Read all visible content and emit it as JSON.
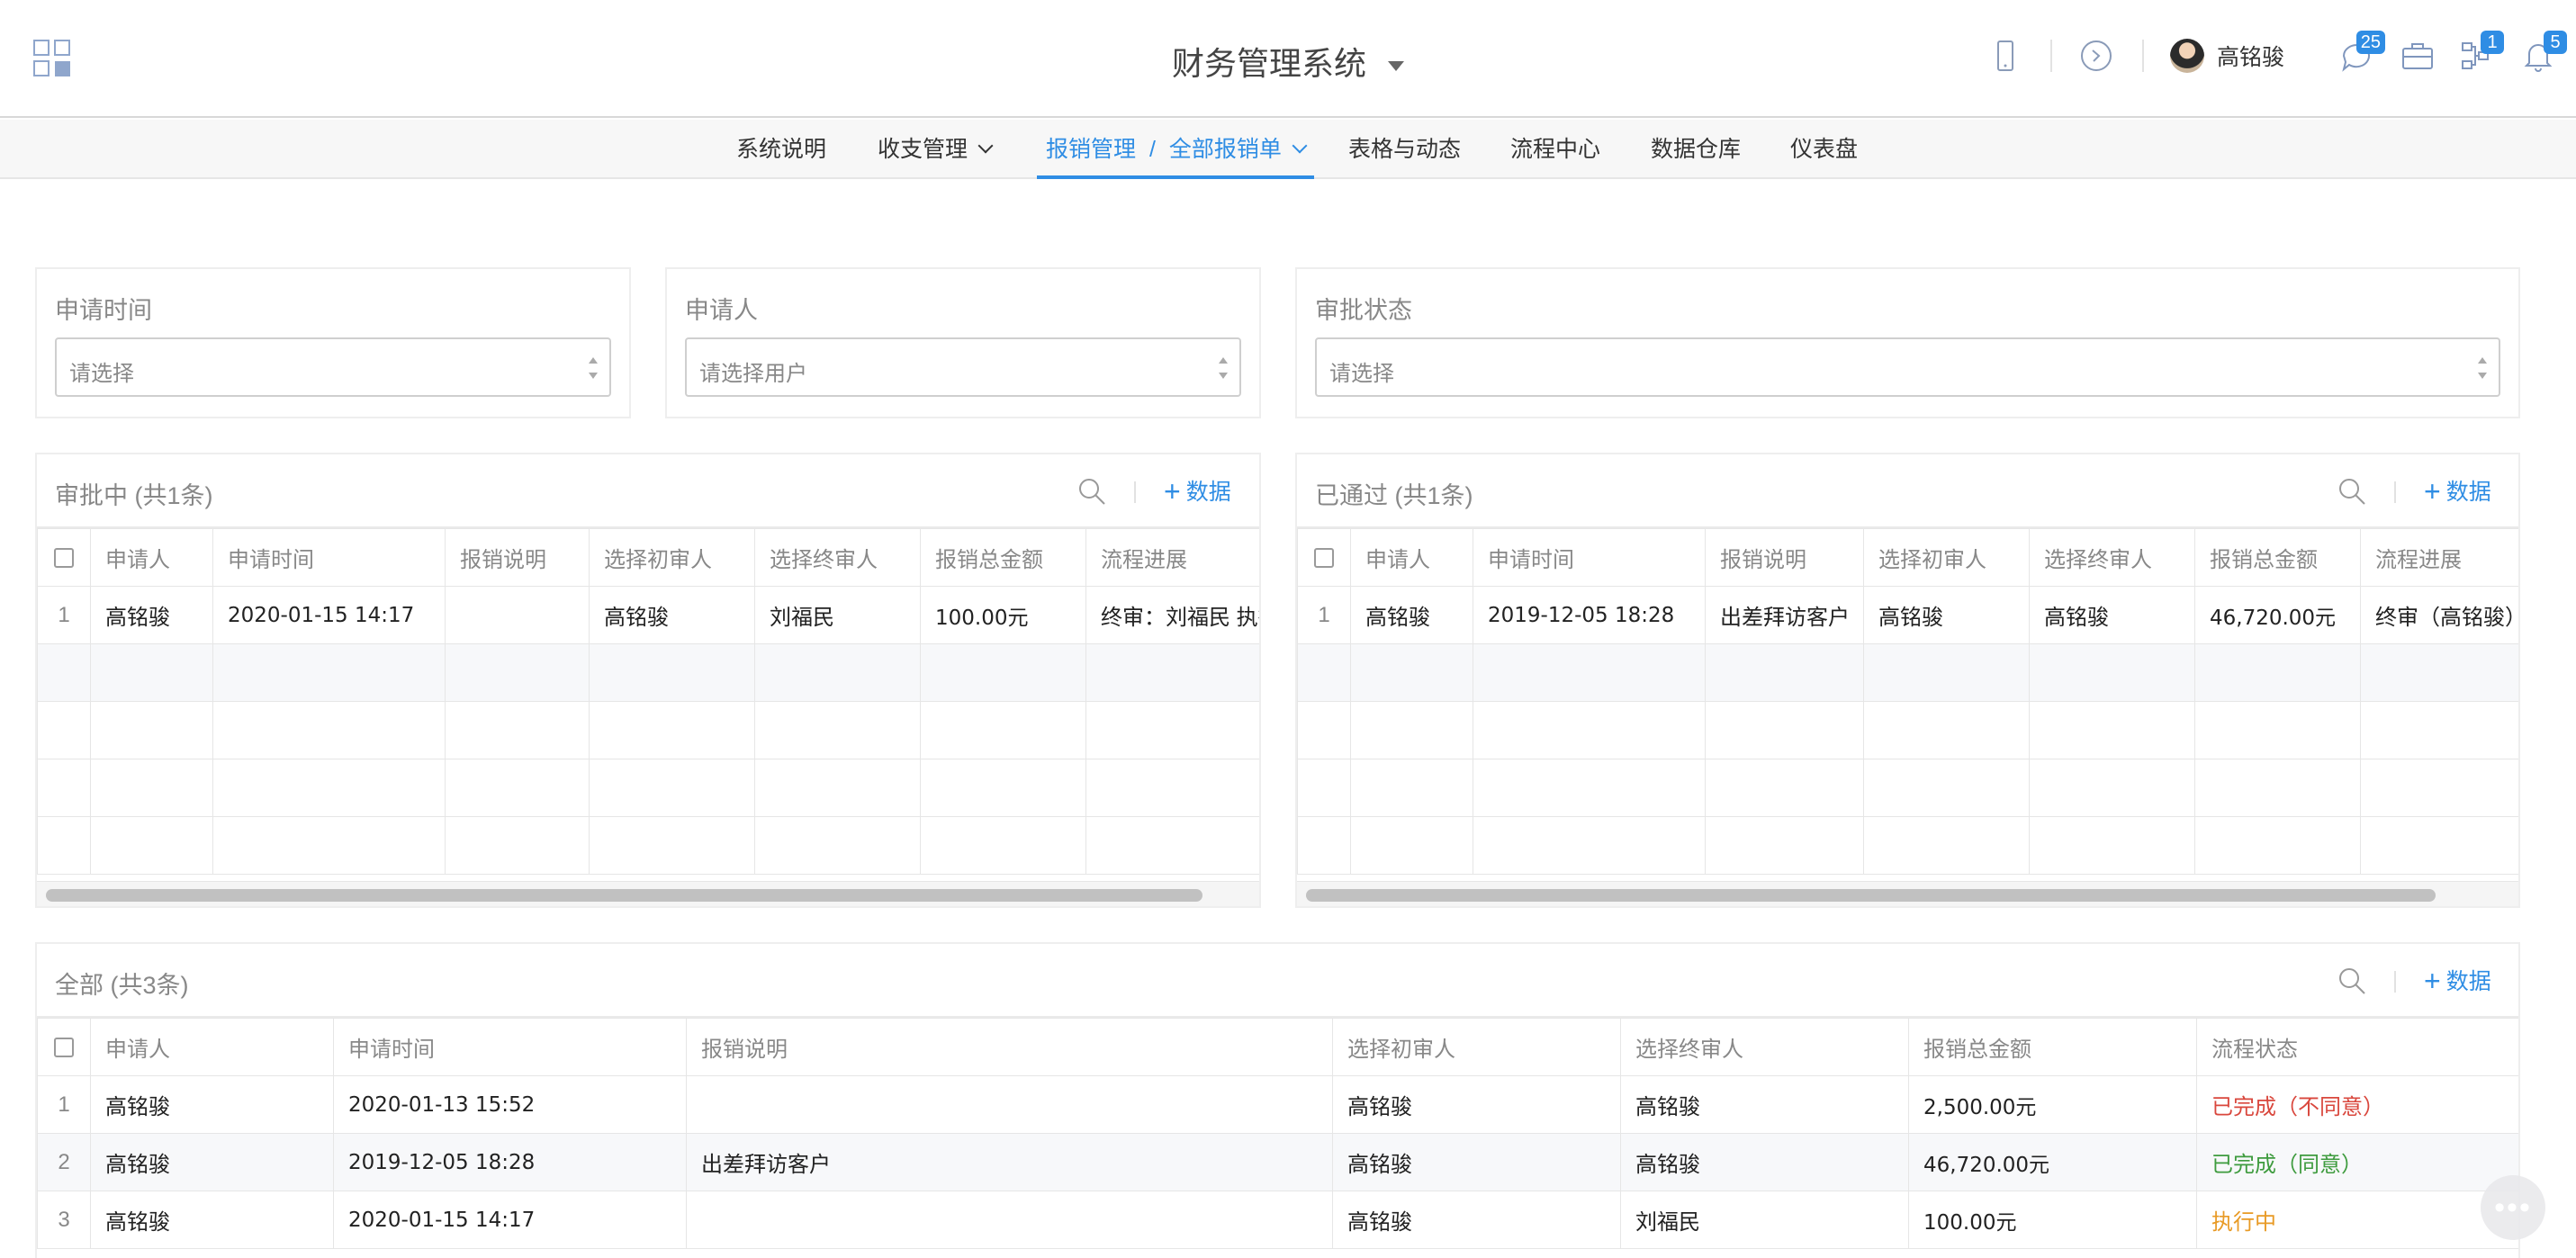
{
  "header": {
    "title": "财务管理系统",
    "user_name": "高铭骏",
    "badges": {
      "chat": "25",
      "flow": "1",
      "bell": "5"
    }
  },
  "nav": {
    "items": [
      "系统说明",
      "收支管理",
      "表格与动态",
      "流程中心",
      "数据仓库",
      "仪表盘"
    ],
    "active_parent": "报销管理",
    "active_sep": "/",
    "active_child": "全部报销单"
  },
  "filters": [
    {
      "label": "申请时间",
      "placeholder": "请选择"
    },
    {
      "label": "申请人",
      "placeholder": "请选择用户"
    },
    {
      "label": "审批状态",
      "placeholder": "请选择"
    }
  ],
  "add_label": "数据",
  "pending": {
    "title": "审批中 (共1条)",
    "columns": [
      "申请人",
      "申请时间",
      "报销说明",
      "选择初审人",
      "选择终审人",
      "报销总金额",
      "流程进展"
    ],
    "rows": [
      [
        "1",
        "高铭骏",
        "2020-01-15 14:17",
        "",
        "高铭骏",
        "刘福民",
        "100.00元",
        "终审：刘福民 执行中"
      ]
    ]
  },
  "approved": {
    "title": "已通过 (共1条)",
    "columns": [
      "申请人",
      "申请时间",
      "报销说明",
      "选择初审人",
      "选择终审人",
      "报销总金额",
      "流程进展"
    ],
    "rows": [
      [
        "1",
        "高铭骏",
        "2019-12-05 18:28",
        "出差拜访客户",
        "高铭骏",
        "高铭骏",
        "46,720.00元",
        "终审（高铭骏）"
      ]
    ]
  },
  "all": {
    "title": "全部 (共3条)",
    "columns": [
      "申请人",
      "申请时间",
      "报销说明",
      "选择初审人",
      "选择终审人",
      "报销总金额",
      "流程状态"
    ],
    "rows": [
      [
        "1",
        "高铭骏",
        "2020-01-13 15:52",
        "",
        "高铭骏",
        "高铭骏",
        "2,500.00元",
        "已完成（不同意）"
      ],
      [
        "2",
        "高铭骏",
        "2019-12-05 18:28",
        "出差拜访客户",
        "高铭骏",
        "高铭骏",
        "46,720.00元",
        "已完成（同意）"
      ],
      [
        "3",
        "高铭骏",
        "2020-01-15 14:17",
        "",
        "高铭骏",
        "刘福民",
        "100.00元",
        "执行中"
      ]
    ],
    "status_colors": [
      "#d9473d",
      "#3e9b3e",
      "#e89a25"
    ]
  },
  "colors": {
    "accent": "#2f8de4"
  },
  "icons": [
    "apps-grid-icon",
    "mobile-icon",
    "clock-link-icon",
    "chat-icon",
    "briefcase-icon",
    "flow-icon",
    "bell-icon",
    "search-icon",
    "more-dots-icon"
  ]
}
